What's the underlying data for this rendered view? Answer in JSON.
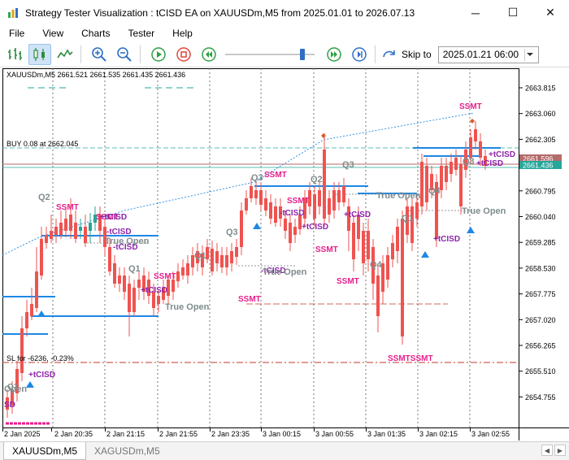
{
  "window": {
    "title": "Strategy Tester Visualization : tCISD EA on XAUUSDm,M5 from 2025.01.01 to 2026.07.13",
    "minimize": "─",
    "maximize": "☐",
    "close": "✕"
  },
  "menu": [
    "File",
    "View",
    "Charts",
    "Tester",
    "Help"
  ],
  "toolbar": {
    "skip_label": "Skip to",
    "skip_value": "2025.01.21 06:00",
    "speed_fraction": 0.88
  },
  "chart": {
    "header": "XAUUSDm,M5  2661.521 2661.535 2661.435 2661.436",
    "buy_label": "BUY 0.08 at 2662.045",
    "sl_label": "SL for -6236, -0.23%",
    "price_ticks": [
      "2663.815",
      "2663.060",
      "2662.305",
      "2661.550",
      "2660.795",
      "2660.040",
      "2659.285",
      "2658.530",
      "2657.775",
      "2657.020",
      "2656.265",
      "2655.510",
      "2654.755"
    ],
    "price_badges": [
      "2661.596",
      "2661.436"
    ],
    "time_ticks": [
      "2 Jan 2025",
      "2 Jan 20:35",
      "2 Jan 21:15",
      "2 Jan 21:55",
      "2 Jan 23:35",
      "3 Jan 00:15",
      "3 Jan 00:55",
      "3 Jan 01:35",
      "3 Jan 02:15",
      "3 Jan 02:55"
    ],
    "annotations": {
      "q_labels": [
        "Q2",
        "Q1",
        "Q1",
        "Q3",
        "Q3",
        "Q2",
        "Q3",
        "Q4",
        "Q1",
        "Q4",
        "Q3"
      ],
      "ssmt": "SSMT",
      "ssmt_pair": "SSMTSSMT",
      "tcisd_plus": "+tCISD",
      "tcisd_minus": "-tCISD",
      "tcisd_multi": "+tCISD",
      "true_open": "True Open",
      "open_partial": "Open",
      "sd_partial": "SD",
      "q1_partial": "Q1"
    }
  },
  "tabs": [
    "XAUUSDm,M5",
    "XAGUSDm,M5"
  ],
  "colors": {
    "bull": "#26a69a",
    "bear": "#ef5350",
    "ssmt": "#e91e8c",
    "tcisd": "#8e24aa",
    "level_blue": "#1e88e5",
    "true_open": "#7f8c8d",
    "accent": "#2f6fc4"
  }
}
